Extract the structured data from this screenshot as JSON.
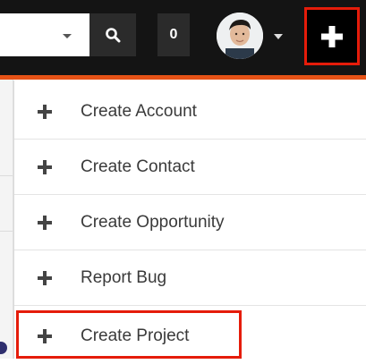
{
  "header": {
    "notification_count": "0",
    "colors": {
      "bar": "#141414",
      "accent": "#e65216",
      "highlight": "#e51c0a"
    }
  },
  "icons": {
    "search": "search-icon",
    "plus": "plus-icon",
    "profile_caret": "chevron-down-icon",
    "search_caret": "chevron-down-icon"
  },
  "menu": {
    "items": [
      {
        "label": "Create Account"
      },
      {
        "label": "Create Contact"
      },
      {
        "label": "Create Opportunity"
      },
      {
        "label": "Report Bug"
      },
      {
        "label": "Create Project"
      }
    ]
  }
}
